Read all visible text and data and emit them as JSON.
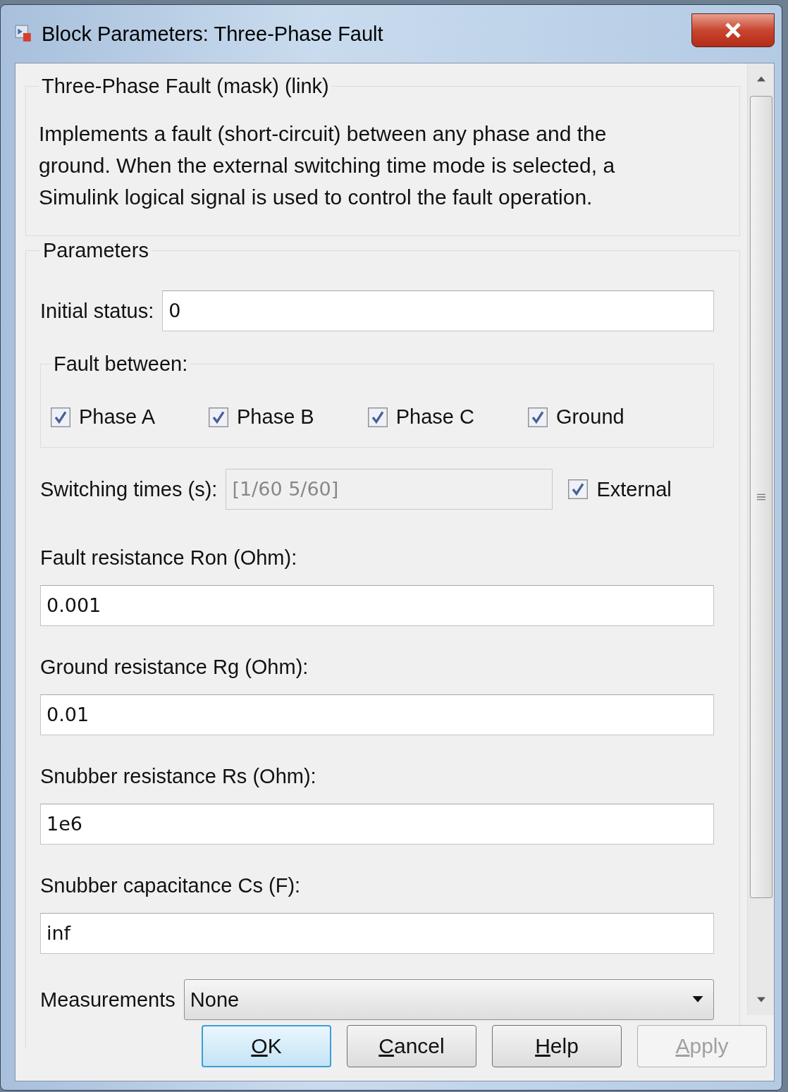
{
  "window": {
    "title": "Block Parameters: Three-Phase Fault"
  },
  "description": {
    "title": "Three-Phase Fault (mask) (link)",
    "text": "Implements a fault (short-circuit) between any phase and the ground. When the external switching time mode is selected, a Simulink logical signal is used to control the fault operation."
  },
  "parameters": {
    "title": "Parameters",
    "items": [
      {
        "kind": "inline_text",
        "label": "Initial status:",
        "value": "0"
      },
      {
        "kind": "checkbox_group",
        "title": "Fault between:",
        "options": [
          {
            "label": "Phase A",
            "checked": true
          },
          {
            "label": "Phase B",
            "checked": true
          },
          {
            "label": "Phase C",
            "checked": true
          },
          {
            "label": "Ground",
            "checked": true
          }
        ]
      },
      {
        "kind": "switching",
        "label": "Switching times (s):",
        "value": "[1/60  5/60]",
        "disabled": true,
        "option": {
          "label": "External",
          "checked": true
        }
      },
      {
        "kind": "stacked_text",
        "label": "Fault resistance Ron (Ohm):",
        "value": "0.001"
      },
      {
        "kind": "stacked_text",
        "label": "Ground resistance Rg (Ohm):",
        "value": "0.01"
      },
      {
        "kind": "stacked_text",
        "label": "Snubber resistance Rs (Ohm):",
        "value": "1e6"
      },
      {
        "kind": "stacked_text",
        "label": "Snubber capacitance Cs (F):",
        "value": "inf"
      },
      {
        "kind": "dropdown",
        "label": "Measurements",
        "value": "None"
      }
    ]
  },
  "buttons": [
    {
      "access_key": "O",
      "label_rest": "K",
      "focused": true,
      "disabled": false
    },
    {
      "access_key": "C",
      "label_rest": "ancel",
      "focused": false,
      "disabled": false
    },
    {
      "access_key": "H",
      "label_rest": "elp",
      "focused": false,
      "disabled": false
    },
    {
      "access_key": "A",
      "label_rest": "pply",
      "focused": false,
      "disabled": true
    }
  ]
}
